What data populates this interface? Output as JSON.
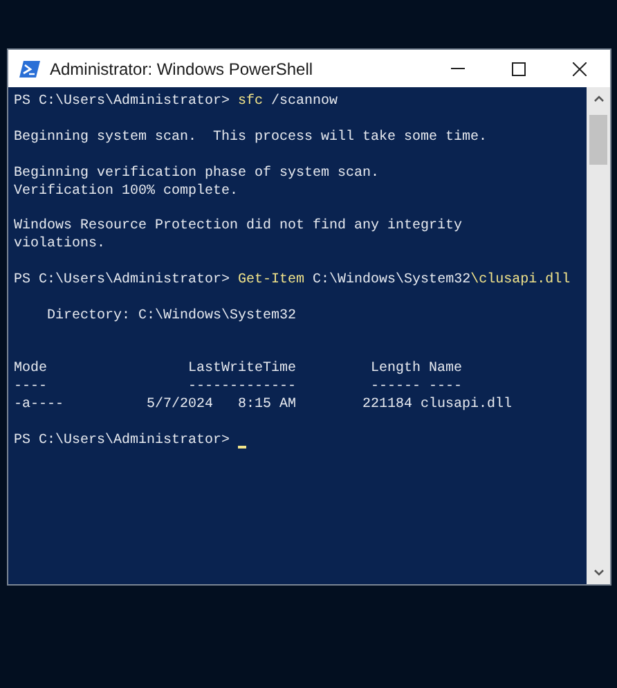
{
  "window": {
    "title": "Administrator: Windows PowerShell"
  },
  "console": {
    "lines": [
      {
        "kind": "text",
        "segments": [
          {
            "kind": "plain",
            "text": "PS C:\\Users\\Administrator> "
          },
          {
            "kind": "command",
            "text": "sfc"
          },
          {
            "kind": "plain",
            "text": " /scannow"
          }
        ]
      },
      {
        "kind": "blank"
      },
      {
        "kind": "text",
        "segments": [
          {
            "kind": "plain",
            "text": "Beginning system scan.  This process will take some time."
          }
        ]
      },
      {
        "kind": "blank"
      },
      {
        "kind": "text",
        "segments": [
          {
            "kind": "plain",
            "text": "Beginning verification phase of system scan."
          }
        ]
      },
      {
        "kind": "text",
        "segments": [
          {
            "kind": "plain",
            "text": "Verification 100% complete."
          }
        ]
      },
      {
        "kind": "blank"
      },
      {
        "kind": "text",
        "segments": [
          {
            "kind": "plain",
            "text": "Windows Resource Protection did not find any integrity"
          }
        ]
      },
      {
        "kind": "text",
        "segments": [
          {
            "kind": "plain",
            "text": "violations."
          }
        ]
      },
      {
        "kind": "blank"
      },
      {
        "kind": "text",
        "segments": [
          {
            "kind": "plain",
            "text": "PS C:\\Users\\Administrator> "
          },
          {
            "kind": "command",
            "text": "Get-Item"
          },
          {
            "kind": "plain",
            "text": " C:\\Windows\\System32"
          },
          {
            "kind": "command",
            "text": "\\clusapi.dll"
          }
        ]
      },
      {
        "kind": "blank"
      },
      {
        "kind": "text",
        "segments": [
          {
            "kind": "plain",
            "text": "    Directory: C:\\Windows\\System32"
          }
        ]
      },
      {
        "kind": "blank"
      },
      {
        "kind": "blank"
      },
      {
        "kind": "text",
        "segments": [
          {
            "kind": "plain",
            "text": "Mode                 LastWriteTime         Length Name"
          }
        ]
      },
      {
        "kind": "text",
        "segments": [
          {
            "kind": "plain",
            "text": "----                 -------------         ------ ----"
          }
        ]
      },
      {
        "kind": "text",
        "segments": [
          {
            "kind": "plain",
            "text": "-a----          5/7/2024   8:15 AM        221184 clusapi.dll"
          }
        ]
      },
      {
        "kind": "blank"
      },
      {
        "kind": "text",
        "cursor": true,
        "segments": [
          {
            "kind": "plain",
            "text": "PS C:\\Users\\Administrator> "
          }
        ]
      }
    ]
  }
}
